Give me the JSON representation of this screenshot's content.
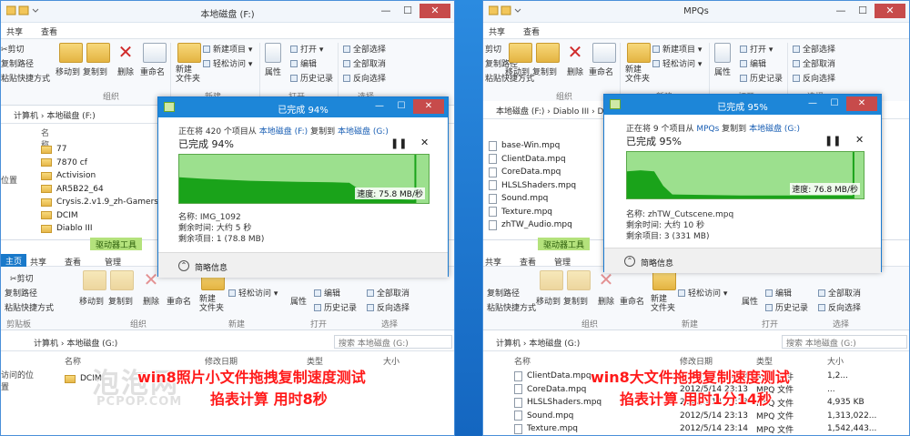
{
  "left": {
    "window_title": "本地磁盘 (F:)",
    "ribbon_top": {
      "cut": "剪切",
      "copy_path": "复制路径",
      "paste_shortcut": "粘贴快捷方式",
      "move_to": "移动到",
      "copy_to": "复制到",
      "delete": "删除",
      "rename": "重命名",
      "new_folder": "新建\n文件夹",
      "new_item": "新建项目",
      "easy_access": "轻松访问",
      "properties": "属性",
      "open": "打开",
      "edit": "编辑",
      "history": "历史记录",
      "select_all": "全部选择",
      "select_none": "全部取消",
      "invert": "反向选择",
      "grp_organize": "组织",
      "grp_new": "新建",
      "grp_open": "打开",
      "grp_select": "选择"
    },
    "addr_top": "计算机 › 本地磁盘 (F:)",
    "nav_top_item": "位置",
    "files_top_header": "名称",
    "files_top": [
      "77",
      "7870 cf",
      "Activision",
      "AR5B22_64",
      "Crysis.2.v1.9_zh-Gamersky",
      "DCIM",
      "Diablo III"
    ],
    "tabs_bottom": {
      "home": "主页",
      "share": "共享",
      "view": "查看",
      "driver_tools": "驱动器工具",
      "manage": "管理"
    },
    "ribbon_bottom": {
      "cut": "剪切",
      "copy_path": "复制路径",
      "paste_shortcut": "粘贴快捷方式",
      "clipboard": "剪贴板",
      "move_to": "移动到",
      "copy_to": "复制到",
      "delete": "删除",
      "rename": "重命名",
      "new_folder": "新建\n文件夹",
      "easy_access": "轻松访问",
      "properties": "属性",
      "edit": "编辑",
      "history": "历史记录",
      "select_none": "全部取消",
      "invert": "反向选择",
      "grp_organize": "组织",
      "grp_new": "新建",
      "grp_open": "打开",
      "grp_select": "选择"
    },
    "addr_bottom": "计算机 › 本地磁盘 (G:)",
    "search_bottom": "搜索 本地磁盘 (G:)",
    "nav_bottom_item": "访问的位置",
    "cols_bottom": {
      "name": "名称",
      "date": "修改日期",
      "type": "类型",
      "size": "大小"
    },
    "files_bottom": [
      "DCIM"
    ],
    "dialog": {
      "title": "已完成 94%",
      "status_prefix": "正在将 420 个项目从",
      "src": "本地磁盘 (F:)",
      "mid": "复制到",
      "dst": "本地磁盘 (G:)",
      "percent_line": "已完成 94%",
      "progress": 0.94,
      "speed": "速度: 75.8 MB/秒",
      "name_line": "名称: IMG_1092",
      "time_line": "剩余时间: 大约 5 秒",
      "items_line": "剩余项目: 1 (78.8 MB)",
      "more": "简略信息"
    },
    "caption_1": "win8照片小文件拖拽复制速度测试",
    "caption_2": "掐表计算 用时8秒"
  },
  "right": {
    "window_title": "MPQs",
    "ribbon_top": {
      "cut": "剪切",
      "copy_path": "复制路径",
      "paste_shortcut": "粘贴快捷方式",
      "move_to": "移动到",
      "copy_to": "复制到",
      "delete": "删除",
      "rename": "重命名",
      "new_folder": "新建\n文件夹",
      "new_item": "新建项目",
      "easy_access": "轻松访问",
      "properties": "属性",
      "open": "打开",
      "edit": "编辑",
      "history": "历史记录",
      "select_all": "全部选择",
      "select_none": "全部取消",
      "invert": "反向选择",
      "grp_organize": "组织",
      "grp_new": "新建",
      "grp_open": "打开",
      "grp_select": "选择"
    },
    "addr_top": "本地磁盘 (F:) › Diablo III › Data_D3",
    "files_top": [
      "base-Win.mpq",
      "ClientData.mpq",
      "CoreData.mpq",
      "HLSLShaders.mpq",
      "Sound.mpq",
      "Texture.mpq",
      "zhTW_Audio.mpq"
    ],
    "tabs_bottom": {
      "share": "共享",
      "view": "查看",
      "driver_tools": "驱动器工具",
      "manage": "管理"
    },
    "ribbon_bottom": {
      "copy_path": "复制路径",
      "paste_shortcut": "粘贴快捷方式",
      "move_to": "移动到",
      "copy_to": "复制到",
      "delete": "删除",
      "rename": "重命名",
      "new_folder": "新建\n文件夹",
      "easy_access": "轻松访问",
      "properties": "属性",
      "edit": "编辑",
      "history": "历史记录",
      "select_none": "全部取消",
      "invert": "反向选择",
      "grp_organize": "组织",
      "grp_new": "新建",
      "grp_open": "打开",
      "grp_select": "选择"
    },
    "addr_bottom": "计算机 › 本地磁盘 (G:)",
    "search_bottom": "搜索 本地磁盘 (G:)",
    "cols_bottom": {
      "name": "名称",
      "date": "修改日期",
      "type": "类型",
      "size": "大小"
    },
    "files_bottom": [
      {
        "name": "ClientData.mpq",
        "date": "2012/5/14 23:13",
        "type": "MPQ 文件",
        "size": "1,2..."
      },
      {
        "name": "CoreData.mpq",
        "date": "2012/5/14 23:13",
        "type": "MPQ 文件",
        "size": "..."
      },
      {
        "name": "HLSLShaders.mpq",
        "date": "2012/5/14 23:13",
        "type": "MPQ 文件",
        "size": "4,935 KB"
      },
      {
        "name": "Sound.mpq",
        "date": "2012/5/14 23:13",
        "type": "MPQ 文件",
        "size": "1,313,022..."
      },
      {
        "name": "Texture.mpq",
        "date": "2012/5/14 23:14",
        "type": "MPQ 文件",
        "size": "1,542,443..."
      }
    ],
    "dialog": {
      "title": "已完成 95%",
      "status_prefix": "正在将 9 个项目从",
      "src": "MPQs",
      "mid": "复制到",
      "dst": "本地磁盘 (G:)",
      "percent_line": "已完成 95%",
      "progress": 0.95,
      "speed": "速度: 76.8 MB/秒",
      "name_line": "名称: zhTW_Cutscene.mpq",
      "time_line": "剩余时间: 大约 10 秒",
      "items_line": "剩余项目: 3 (331 MB)",
      "more": "简略信息"
    },
    "caption_1": "win8大文件拖拽复制速度测试",
    "caption_2": "掐表计算 用时1分14秒"
  },
  "watermark": {
    "cn": "泡泡网",
    "en": "PCPOP.COM"
  },
  "colors": {
    "accent": "#1d86d8",
    "graph_fill": "#9ce08e",
    "graph_area": "#1aa31a",
    "caption": "#ff1a1a",
    "driver_tools": "#b4e27c"
  }
}
